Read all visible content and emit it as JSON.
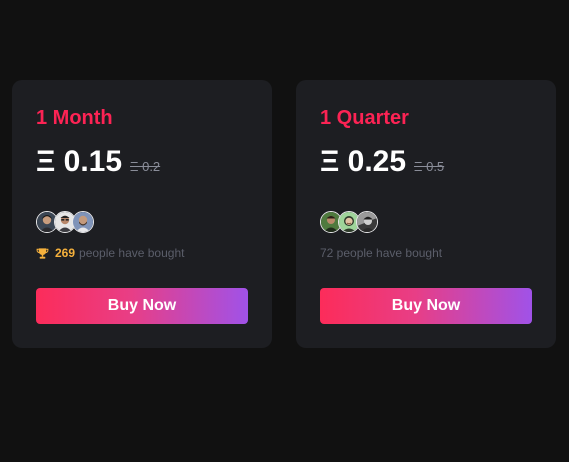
{
  "cards": [
    {
      "title": "1 Month",
      "price": "Ξ 0.15",
      "old_price": "Ξ 0.2",
      "bought_count": "269",
      "bought_text": "people have bought",
      "button_label": "Buy Now",
      "avatars": [
        "avatar-dark-hair-man",
        "avatar-man-glasses",
        "avatar-man-beard"
      ]
    },
    {
      "title": "1 Quarter",
      "price": "Ξ 0.25",
      "old_price": "Ξ 0.5",
      "bought_text": "72 people have bought",
      "button_label": "Buy Now",
      "avatars": [
        "avatar-green-outdoor",
        "avatar-smiling-person",
        "avatar-monochrome-person"
      ]
    }
  ],
  "colors": {
    "background": "#111111",
    "card": "#1d1e22",
    "title_accent": "#fc2354",
    "bought_count": "#f6b13c",
    "button_gradient_start": "#fc2c5a",
    "button_gradient_end": "#a052e8"
  },
  "icons": {
    "trophy": "trophy-icon"
  }
}
